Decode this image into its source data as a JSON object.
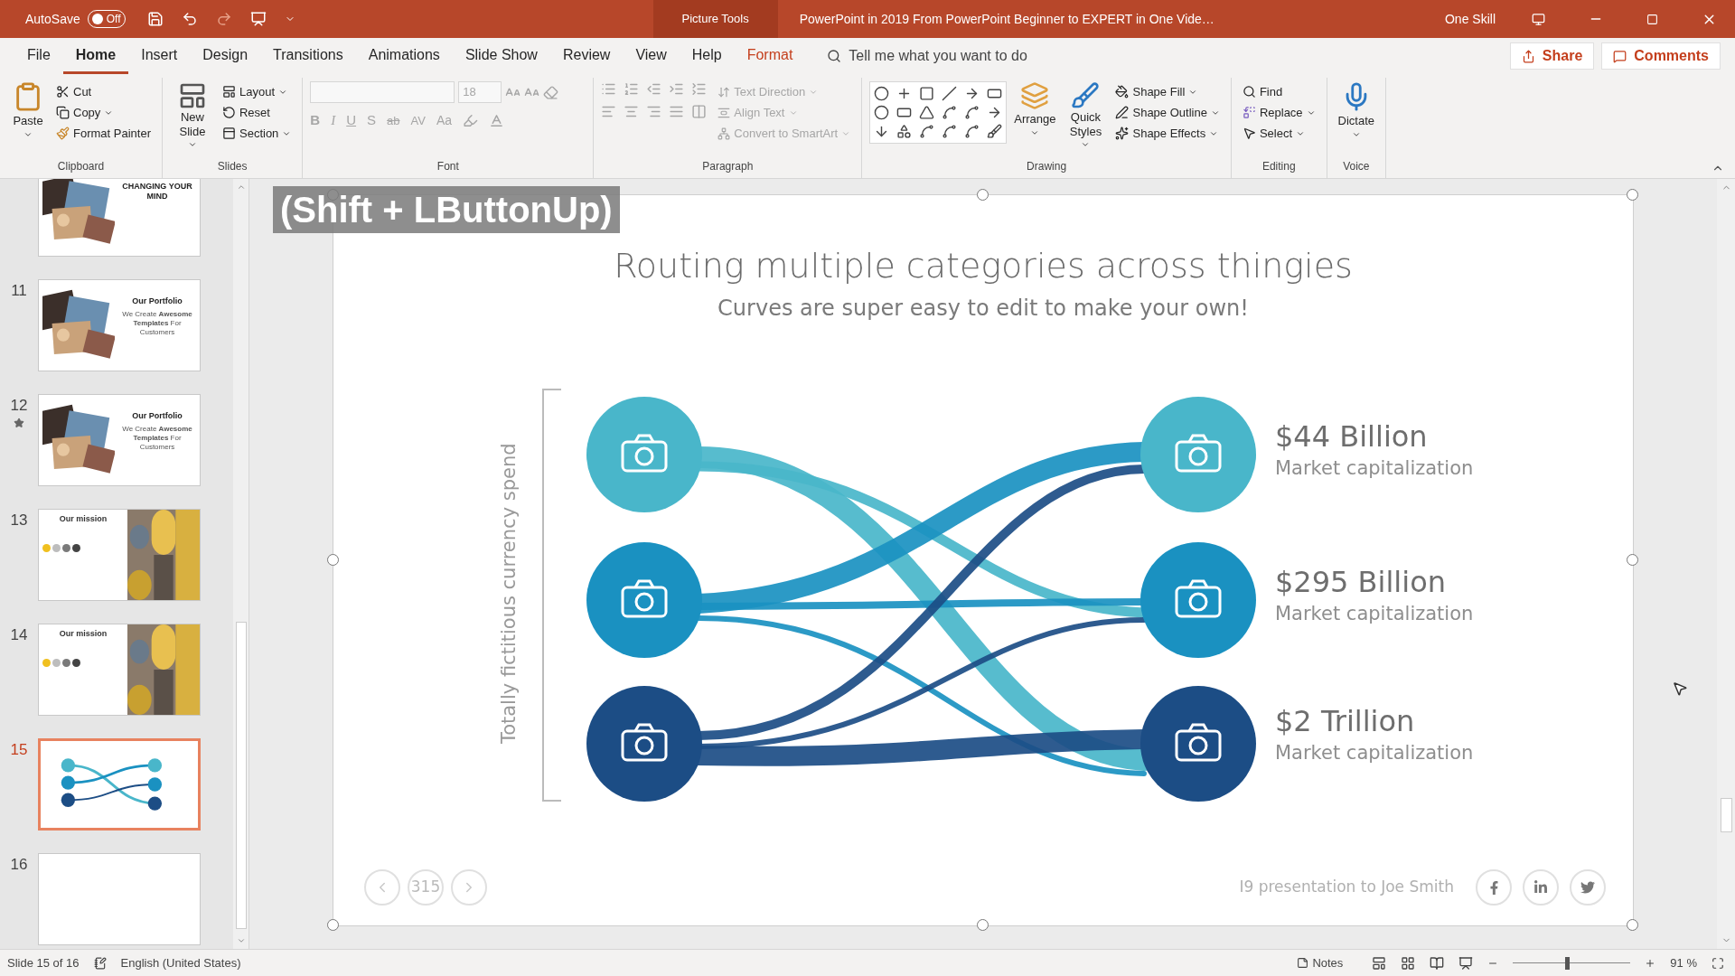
{
  "title_bar": {
    "autosave": {
      "label": "AutoSave",
      "state": "Off",
      "on": false
    },
    "context_tab": "Picture Tools",
    "title": "PowerPoint in 2019 From PowerPoint Beginner to EXPERT in One Vide…",
    "user": "One Skill"
  },
  "menu_tabs": [
    {
      "label": "File",
      "selected": false,
      "kind": "normal"
    },
    {
      "label": "Home",
      "selected": true,
      "kind": "normal"
    },
    {
      "label": "Insert",
      "selected": false,
      "kind": "normal"
    },
    {
      "label": "Design",
      "selected": false,
      "kind": "normal"
    },
    {
      "label": "Transitions",
      "selected": false,
      "kind": "normal"
    },
    {
      "label": "Animations",
      "selected": false,
      "kind": "normal"
    },
    {
      "label": "Slide Show",
      "selected": false,
      "kind": "normal"
    },
    {
      "label": "Review",
      "selected": false,
      "kind": "normal"
    },
    {
      "label": "View",
      "selected": false,
      "kind": "normal"
    },
    {
      "label": "Help",
      "selected": false,
      "kind": "normal"
    },
    {
      "label": "Format",
      "selected": false,
      "kind": "contextual"
    }
  ],
  "tell_me": {
    "placeholder": "Tell me what you want to do"
  },
  "share": "Share",
  "comments": "Comments",
  "ribbon": {
    "clipboard": {
      "label": "Clipboard",
      "paste": "Paste",
      "cut": "Cut",
      "copy": "Copy",
      "format_painter": "Format Painter"
    },
    "slides": {
      "label": "Slides",
      "new_slide": "New Slide",
      "layout": "Layout",
      "reset": "Reset",
      "section": "Section"
    },
    "font": {
      "label": "Font",
      "size": "18",
      "disabled": true,
      "bold": "B",
      "italic": "I",
      "underline": "U",
      "shadow": "S",
      "strike": "ab",
      "spacing": "AV",
      "case": "Aa"
    },
    "paragraph": {
      "label": "Paragraph",
      "disabled": true,
      "text_direction": "Text Direction",
      "align_text": "Align Text",
      "convert": "Convert to SmartArt"
    },
    "drawing": {
      "label": "Drawing",
      "arrange": "Arrange",
      "quick_styles": "Quick Styles",
      "shape_fill": "Shape Fill",
      "shape_outline": "Shape Outline",
      "shape_effects": "Shape Effects"
    },
    "editing": {
      "label": "Editing",
      "find": "Find",
      "replace": "Replace",
      "select": "Select"
    },
    "voice": {
      "label": "Voice",
      "dictate": "Dictate"
    }
  },
  "thumbnails": [
    {
      "title": "CHANGING YOUR MIND",
      "selected": false
    },
    {
      "number": "11",
      "title": "Our Portfolio",
      "text": "We Create **Awesome Templates** For Customers",
      "selected": false,
      "starred": false
    },
    {
      "number": "12",
      "title": "Our Portfolio",
      "text": "We Create **Awesome Templates** For Customers",
      "selected": false,
      "starred": true
    },
    {
      "number": "13",
      "title": "Our mission",
      "kind": "mission",
      "selected": false,
      "starred": false
    },
    {
      "number": "14",
      "title": "Our mission",
      "kind": "mission",
      "selected": false,
      "starred": false
    },
    {
      "number": "15",
      "kind": "diagram",
      "selected": true,
      "starred": false
    },
    {
      "number": "16",
      "kind": "blank",
      "selected": false,
      "starred": false
    }
  ],
  "slide": {
    "overlay": "(Shift + LButtonUp)",
    "title": "Routing multiple categories across thingies",
    "subtitle": "Curves are super easy to edit to make your own!",
    "axis_label": "Totally fictitious currency spend",
    "entries": [
      {
        "value": "$44 Billion",
        "label": "Market capitalization",
        "color": "#49b6ca"
      },
      {
        "value": "$295 Billion",
        "label": "Market capitalization",
        "color": "#1a91c1"
      },
      {
        "value": "$2 Trillion",
        "label": "Market capitalization",
        "color": "#1c4d85"
      }
    ],
    "page": "315",
    "presenter": "I9 presentation to Joe Smith"
  },
  "status_bar": {
    "slide": "Slide 15 of 16",
    "language": "English (United States)",
    "notes": "Notes",
    "zoom": "91 %",
    "zoom_slider": {
      "level": 0.46
    }
  }
}
